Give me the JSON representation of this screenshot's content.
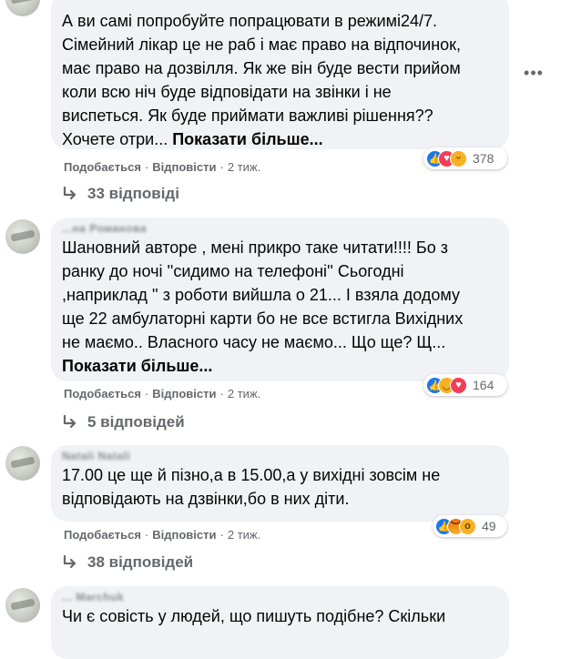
{
  "comments": [
    {
      "text": "А ви самі попробуйте попрацювати в режимі24/7.\nСімейний лікар це не раб і має право на відпочинок,\nмає право на дозвілля. Як же він буде вести прийом\nколи всю ніч буде відповідати на звінки і не\nвиспеться. Як буде приймати важливі рішення??\nХочете отри... ",
      "see_more": "Показати більше...",
      "like": "Подобається",
      "reply": "Відповісти",
      "time": "2 тиж.",
      "reaction_icons": [
        "like",
        "love",
        "haha"
      ],
      "reaction_count": "378",
      "replies_label": "33 відповіді"
    },
    {
      "author": "...на Романова",
      "text": "Шановний авторе , мені прикро таке читати!!!! Бо з\nранку до ночі ''сидимо на телефоні'' Сьогодні\n,наприклад '' з роботи вийшла о 21... І взяла додому\nще 22 амбулаторні карти бо не все встигла Вихідних\nне маємо.. Власного часу не маємо... Що ще? Щ...",
      "see_more": "Показати більше...",
      "like": "Подобається",
      "reply": "Відповісти",
      "time": "2 тиж.",
      "reaction_icons": [
        "like",
        "sad",
        "love"
      ],
      "reaction_count": "164",
      "replies_label": "5 відповідей"
    },
    {
      "author": "Natali Natali",
      "text": "17.00 це ще й пізно,а в 15.00,а у вихідні зовсім не\nвідповідають на дзвінки,бо в них діти.",
      "like": "Подобається",
      "reply": "Відповісти",
      "time": "2 тиж.",
      "reaction_icons": [
        "like",
        "angry",
        "wow"
      ],
      "reaction_count": "49",
      "replies_label": "38 відповідей"
    },
    {
      "author": "... Marchuk",
      "text": "Чи є совість у людей, що пишуть подібне? Скільки"
    }
  ],
  "icons": {
    "options": "more-options-icon",
    "reply_arrow": "reply-arrow-icon"
  },
  "colors": {
    "bubble": "#f0f2f5",
    "secondary_text": "#65676b",
    "like_blue": "#1877f2",
    "love_red": "#f33e58",
    "emoji_yellow": "#f7b125"
  }
}
